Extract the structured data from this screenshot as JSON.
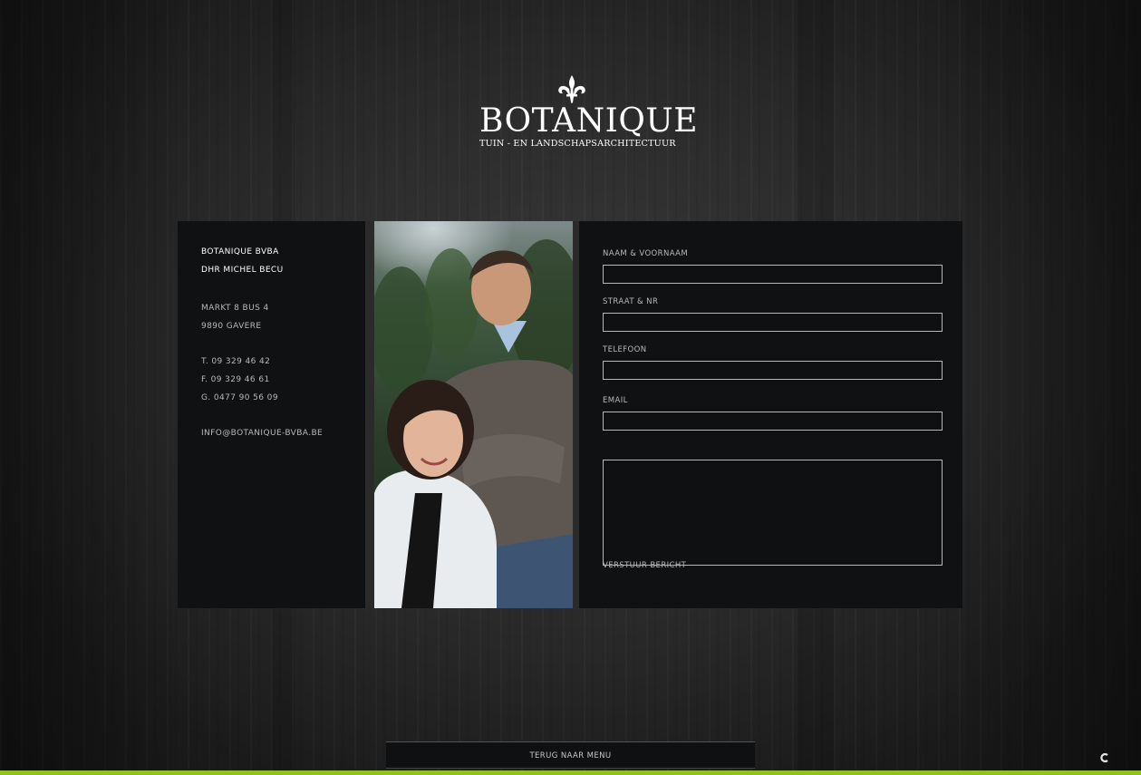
{
  "brand": {
    "name": "BOTANIQUE",
    "tagline": "TUIN - EN LANDSCHAPSARCHITECTUUR",
    "logo_icon": "fleur-de-lis-icon"
  },
  "contact": {
    "company": "BOTANIQUE BVBA",
    "person": "DHR MICHEL BECU",
    "address_line1": "MARKT 8 BUS 4",
    "address_line2": "9890 GAVERE",
    "phone": "T. 09 329 46 42",
    "fax": "F. 09 329 46 61",
    "mobile": "G. 0477 90 56 09",
    "email": "INFO@BOTANIQUE-BVBA.BE"
  },
  "form": {
    "name_label": "NAAM & VOORNAAM",
    "name_value": "",
    "street_label": "STRAAT & NR",
    "street_value": "",
    "phone_label": "TELEFOON",
    "phone_value": "",
    "email_label": "EMAIL",
    "email_value": "",
    "message_value": "",
    "submit_label": "VERSTUUR BERICHT"
  },
  "footer": {
    "back_label": "TERUG NAAR MENU",
    "corner_icon": "spinner-icon"
  },
  "colors": {
    "accent_strip": "#8dc31f",
    "panel": "#101113"
  }
}
